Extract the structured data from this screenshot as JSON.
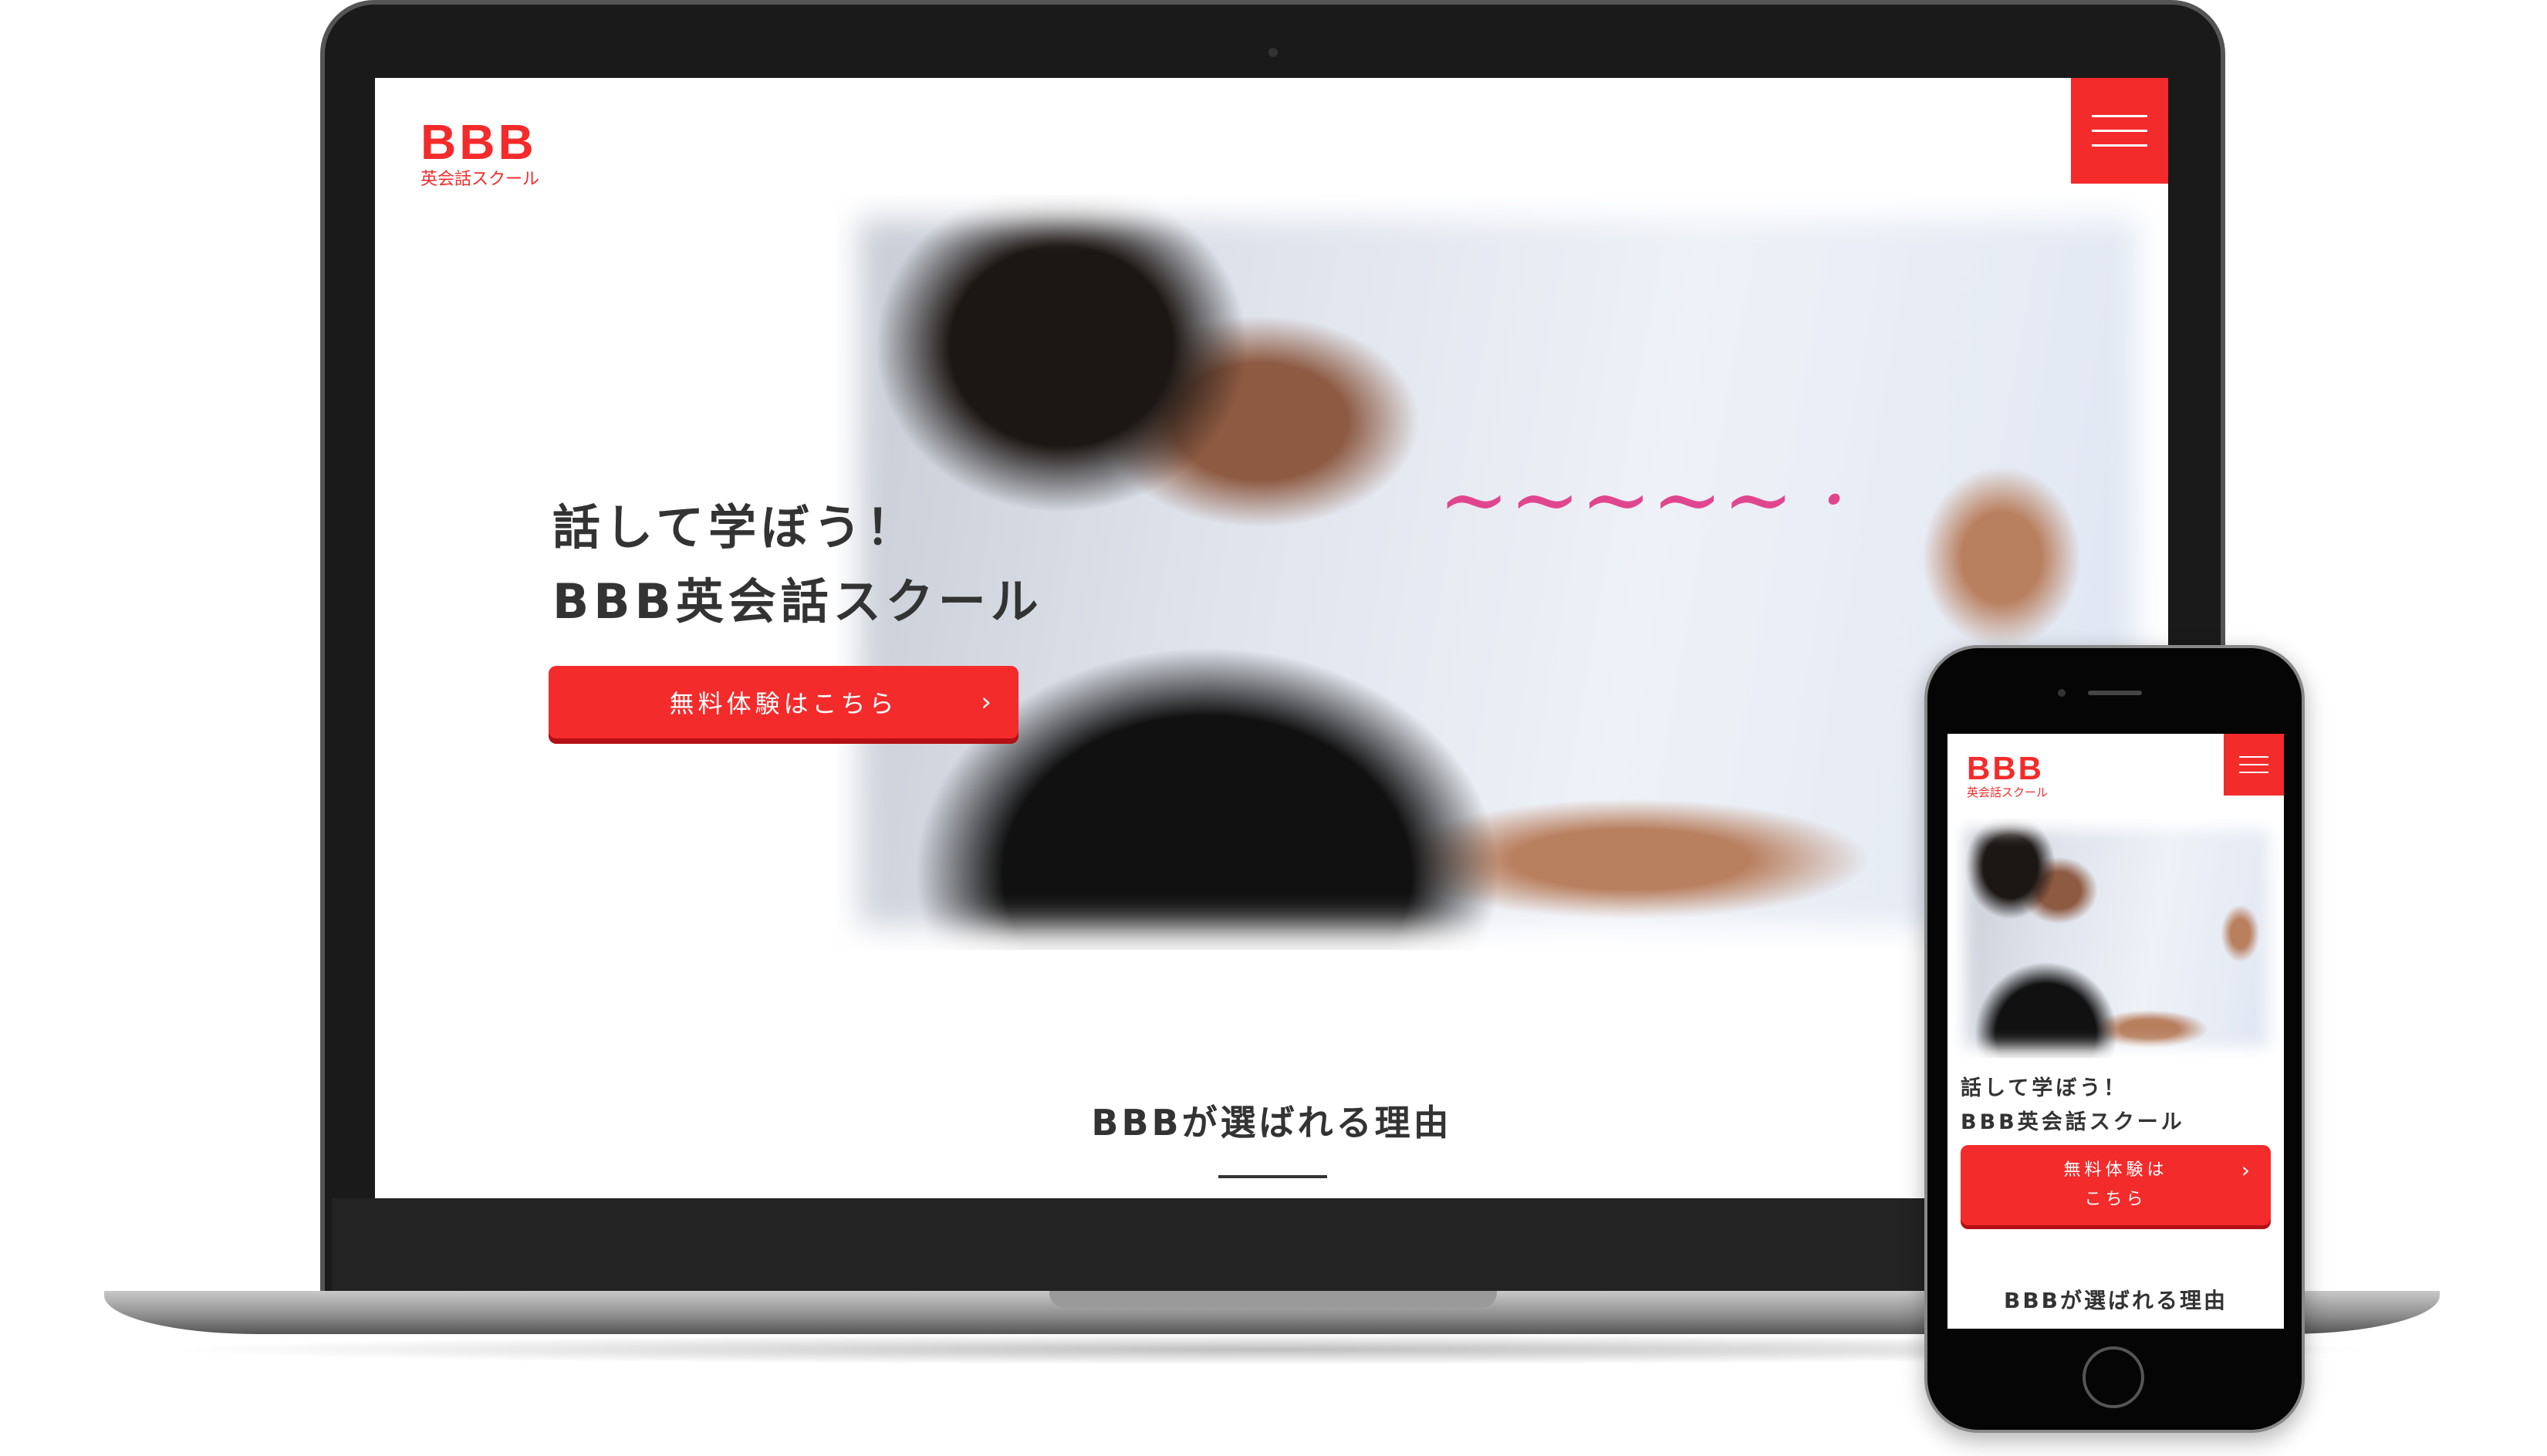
{
  "site": {
    "logo_main": "BBB",
    "logo_sub": "英会話スクール",
    "menu_icon": "hamburger-menu-icon",
    "hero_line1": "話して学ぼう！",
    "hero_line2": "BBB英会話スクール",
    "cta_label": "無料体験はこちら",
    "cta_label_mobile_line1": "無料体験は",
    "cta_label_mobile_line2": "こちら",
    "cta_icon": "chevron-right-icon",
    "section_title": "BBBが選ばれる理由"
  },
  "colors": {
    "accent": "#f42b2b",
    "text": "#333333",
    "button_shadow": "#b30f15"
  }
}
